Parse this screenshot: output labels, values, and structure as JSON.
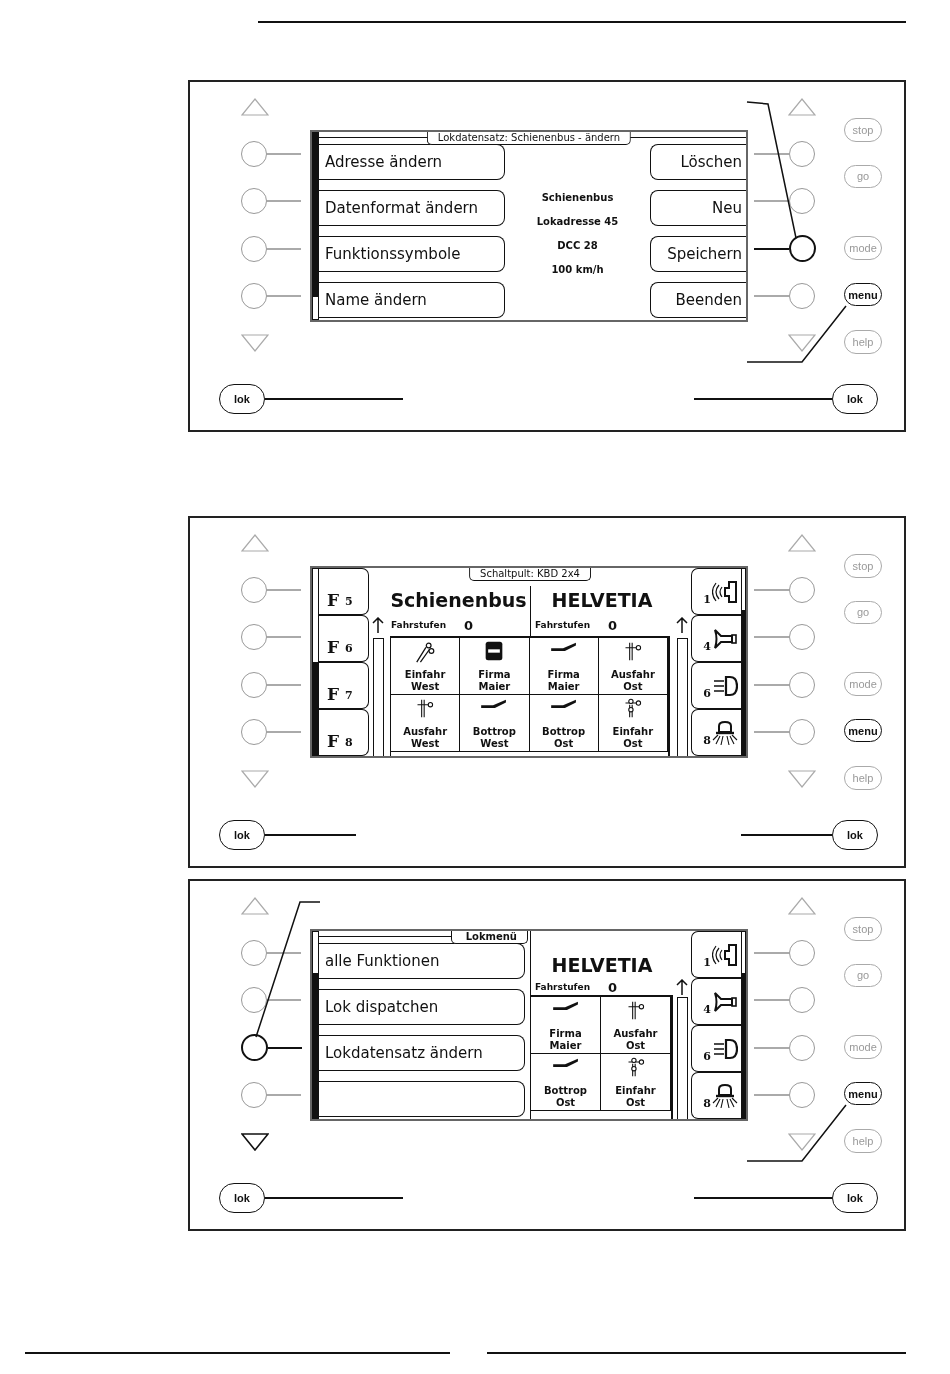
{
  "panels": [
    {
      "left_up": {
        "active": false
      },
      "left_down": {
        "active": false
      },
      "right_up": {
        "active": false
      },
      "right_down": {
        "active": false
      },
      "left_keys": [
        {
          "active": false,
          "pointed": false
        },
        {
          "active": false,
          "pointed": false
        },
        {
          "active": false,
          "pointed": false
        },
        {
          "active": false,
          "pointed": false
        }
      ],
      "right_keys": [
        {
          "active": false,
          "pointed": false
        },
        {
          "active": false,
          "pointed": false
        },
        {
          "active": true,
          "pointed": true
        },
        {
          "active": false,
          "pointed": false
        }
      ],
      "side_buttons": [
        {
          "label": "stop",
          "active": false,
          "pointed": false
        },
        {
          "label": "go",
          "active": false,
          "pointed": false
        },
        {
          "label": "mode",
          "active": false,
          "pointed": false
        },
        {
          "label": "menu",
          "active": true,
          "pointed": true
        },
        {
          "label": "help",
          "active": false,
          "pointed": false
        }
      ],
      "lok_buttons": [
        "lok",
        "lok"
      ],
      "screen": {
        "kind": "record_edit",
        "title": "Lokdatensatz: Schienenbus - ändern",
        "left_buttons": [
          "Adresse ändern",
          "Datenformat ändern",
          "Funktionssymbole",
          "Name ändern"
        ],
        "info": [
          "Schienenbus",
          "Lokadresse 45",
          "DCC 28",
          "100 km/h"
        ],
        "right_buttons": [
          "Löschen",
          "Neu",
          "Speichern",
          "Beenden"
        ]
      }
    },
    {
      "left_up": {
        "active": false
      },
      "left_down": {
        "active": false
      },
      "right_up": {
        "active": false
      },
      "right_down": {
        "active": false
      },
      "left_keys": [
        {
          "active": false,
          "pointed": false
        },
        {
          "active": false,
          "pointed": false
        },
        {
          "active": false,
          "pointed": false
        },
        {
          "active": false,
          "pointed": false
        }
      ],
      "right_keys": [
        {
          "active": false,
          "pointed": false
        },
        {
          "active": false,
          "pointed": false
        },
        {
          "active": false,
          "pointed": false
        },
        {
          "active": false,
          "pointed": false
        }
      ],
      "side_buttons": [
        {
          "label": "stop",
          "active": false,
          "pointed": false
        },
        {
          "label": "go",
          "active": false,
          "pointed": false
        },
        {
          "label": "mode",
          "active": false,
          "pointed": false
        },
        {
          "label": "menu",
          "active": true,
          "pointed": false
        },
        {
          "label": "help",
          "active": false,
          "pointed": false
        }
      ],
      "lok_buttons": [
        "lok",
        "lok"
      ],
      "screen": {
        "kind": "switchboard",
        "title": "Schaltpult: KBD 2x4",
        "fkeys": [
          {
            "letter": "F",
            "number": "5"
          },
          {
            "letter": "F",
            "number": "6"
          },
          {
            "letter": "F",
            "number": "7"
          },
          {
            "letter": "F",
            "number": "8"
          }
        ],
        "locos": [
          {
            "name": "Schienenbus",
            "speed_label": "Fahrstufen",
            "speed": "0"
          },
          {
            "name": "HELVETIA",
            "speed_label": "Fahrstufen",
            "speed": "0"
          }
        ],
        "cells": [
          {
            "kind": "signal_pair",
            "label": "Einfahr West"
          },
          {
            "kind": "stop_block",
            "label": "Firma Maier"
          },
          {
            "kind": "turnout",
            "label": "Firma Maier"
          },
          {
            "kind": "signal",
            "label": "Ausfahr Ost"
          },
          {
            "kind": "signal",
            "label": "Ausfahr West"
          },
          {
            "kind": "turnout",
            "label": "Bottrop West"
          },
          {
            "kind": "turnout",
            "label": "Bottrop Ost"
          },
          {
            "kind": "signal_home",
            "label": "Einfahr Ost"
          }
        ],
        "functions": [
          {
            "number": "1",
            "kind": "sound"
          },
          {
            "number": "4",
            "kind": "horn"
          },
          {
            "number": "6",
            "kind": "light"
          },
          {
            "number": "8",
            "kind": "beacon"
          }
        ]
      }
    },
    {
      "left_up": {
        "active": false
      },
      "left_down": {
        "active": true
      },
      "right_up": {
        "active": false
      },
      "right_down": {
        "active": false
      },
      "left_keys": [
        {
          "active": false,
          "pointed": false
        },
        {
          "active": false,
          "pointed": false
        },
        {
          "active": true,
          "pointed": true
        },
        {
          "active": false,
          "pointed": false
        }
      ],
      "right_keys": [
        {
          "active": false,
          "pointed": false
        },
        {
          "active": false,
          "pointed": false
        },
        {
          "active": false,
          "pointed": false
        },
        {
          "active": false,
          "pointed": false
        }
      ],
      "side_buttons": [
        {
          "label": "stop",
          "active": false,
          "pointed": false
        },
        {
          "label": "go",
          "active": false,
          "pointed": false
        },
        {
          "label": "mode",
          "active": false,
          "pointed": false
        },
        {
          "label": "menu",
          "active": true,
          "pointed": true
        },
        {
          "label": "help",
          "active": false,
          "pointed": false
        }
      ],
      "lok_buttons": [
        "lok",
        "lok"
      ],
      "screen": {
        "kind": "loco_menu",
        "title": "Lokmenü",
        "menu": [
          {
            "kind": "entry",
            "label": "alle Funktionen"
          },
          {
            "kind": "entry",
            "label": "Lok dispatchen"
          },
          {
            "kind": "entry",
            "label": "Lokdatensatz ändern"
          },
          {
            "kind": "blank"
          }
        ],
        "loco": {
          "name": "HELVETIA",
          "speed_label": "Fahrstufen",
          "speed": "0"
        },
        "cells": [
          {
            "kind": "turnout",
            "label": "Firma Maier"
          },
          {
            "kind": "signal",
            "label": "Ausfahr Ost"
          },
          {
            "kind": "turnout",
            "label": "Bottrop Ost"
          },
          {
            "kind": "signal_home",
            "label": "Einfahr Ost"
          }
        ],
        "functions": [
          {
            "number": "1",
            "kind": "sound"
          },
          {
            "number": "4",
            "kind": "horn"
          },
          {
            "number": "6",
            "kind": "light"
          },
          {
            "number": "8",
            "kind": "beacon"
          }
        ]
      }
    }
  ]
}
